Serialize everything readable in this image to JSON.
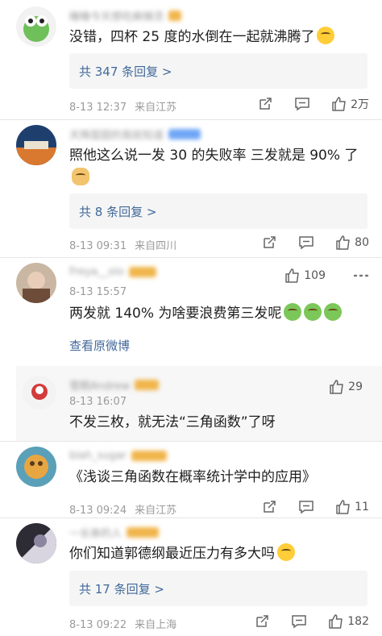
{
  "comments": [
    {
      "username": "睡睡今天想吃麻辣烫",
      "text": "没错，四杯 25 度的水倒在一起就沸腾了",
      "emoji": "sweat-smile-emoji",
      "replies_label": "共 347 条回复 >",
      "date": "8-13 12:37",
      "location": "来自江苏",
      "likes": "2万"
    },
    {
      "username": "天降甜甜的我就知道",
      "text": "照他这么说一发 30 的失败率  三发就是 90% 了",
      "emoji": "doge-emoji",
      "replies_label": "共 8 条回复 >",
      "date": "8-13 09:31",
      "location": "来自四川",
      "likes": "80"
    },
    {
      "username": "Freya__olo",
      "date": "8-13 15:57",
      "likes": "109",
      "text": "两发就 140% 为啥要浪费第三发呢",
      "emoji": "frog-emoji",
      "view_original": "查看原微博",
      "reply": {
        "username": "雪糕Andrew",
        "date": "8-13 16:07",
        "likes": "29",
        "text": "不发三枚，就无法“三角函数”了呀"
      }
    },
    {
      "username": "blah_sugar",
      "text": "《浅谈三角函数在概率统计学中的应用》",
      "date": "8-13 09:24",
      "location": "来自江苏",
      "likes": "11"
    },
    {
      "username": "一长串的人",
      "text": "你们知道郭德纲最近压力有多大吗",
      "emoji": "laughing-tears-emoji",
      "replies_label": "共 17 条回复 >",
      "date": "8-13 09:22",
      "location": "来自上海",
      "likes": "182"
    }
  ],
  "icons": {
    "share": "share-icon",
    "comment": "comment-icon",
    "like": "thumbs-up-icon",
    "more": "more-options-icon"
  },
  "colors": {
    "link": "#41699a",
    "meta": "#9b9b9b",
    "badge_gold": "#f0b54a",
    "badge_blue": "#6fa6f5"
  }
}
